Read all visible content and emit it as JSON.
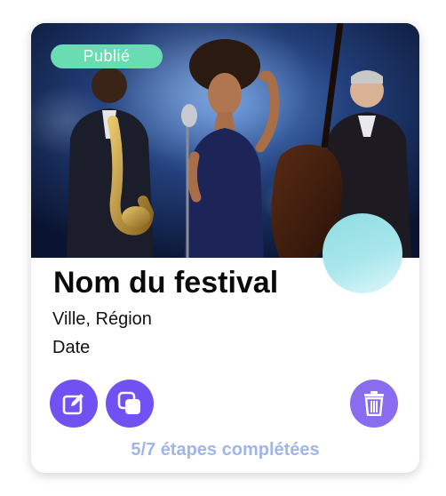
{
  "card": {
    "status": "Publié",
    "festival_name": "Nom du festival",
    "location": "Ville, Région",
    "date": "Date",
    "progress_text": "5/7 étapes complétées",
    "image_alt": "Jazz band performing on stage"
  },
  "actions": {
    "edit_icon": "edit-icon",
    "duplicate_icon": "duplicate-icon",
    "delete_icon": "trash-icon"
  },
  "colors": {
    "badge": "#69dcb2",
    "action_button": "#7151f2",
    "delete_button": "#8a6cf0",
    "progress_text": "#9fb6ec",
    "avatar": "#a8e6ec"
  }
}
